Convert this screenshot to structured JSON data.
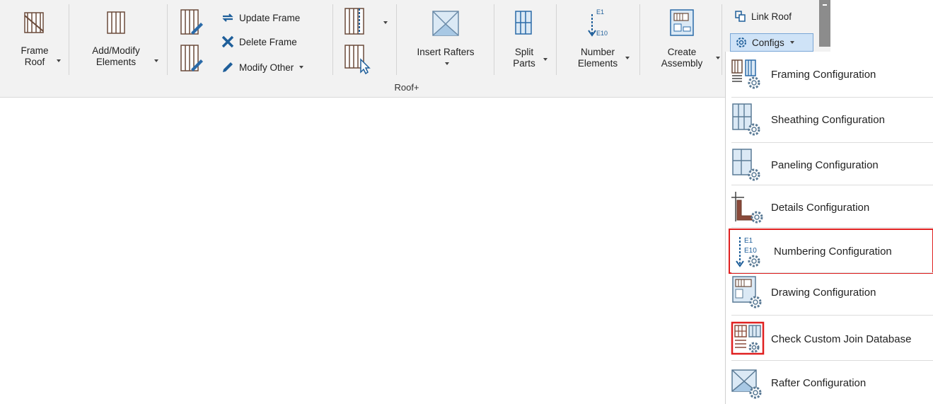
{
  "ribbon": {
    "panel_title": "Roof+",
    "buttons": {
      "frame_roof": [
        "Frame",
        "Roof"
      ],
      "add_modify": [
        "Add/Modify",
        "Elements"
      ],
      "insert_rafters": "Insert Rafters",
      "split_parts": [
        "Split",
        "Parts"
      ],
      "number_elements": [
        "Number",
        "Elements"
      ],
      "create_assembly": [
        "Create",
        "Assembly"
      ]
    },
    "small": {
      "update_frame": "Update Frame",
      "delete_frame": "Delete Frame",
      "modify_other": "Modify Other",
      "link_roof": "Link Roof",
      "configs": "Configs"
    }
  },
  "menu": {
    "items": [
      {
        "label": "Framing Configuration",
        "icon": "framing-config-icon"
      },
      {
        "label": "Sheathing Configuration",
        "icon": "sheathing-config-icon"
      },
      {
        "label": "Paneling Configuration",
        "icon": "paneling-config-icon"
      },
      {
        "label": "Details Configuration",
        "icon": "details-config-icon"
      },
      {
        "label": "Numbering Configuration",
        "icon": "numbering-config-icon",
        "highlighted": true
      },
      {
        "label": "Drawing Configuration",
        "icon": "drawing-config-icon"
      },
      {
        "label": "Check Custom Join Database",
        "icon": "custom-join-db-icon"
      },
      {
        "label": "Rafter Configuration",
        "icon": "rafter-config-icon"
      }
    ]
  },
  "icon_labels": {
    "e1": "E1",
    "e10": "E10"
  },
  "colors": {
    "highlight": "#e02020",
    "configs_bg": "#cfe3f7",
    "accent_blue": "#2a7ab8",
    "frame_brown": "#8a4a3a"
  }
}
